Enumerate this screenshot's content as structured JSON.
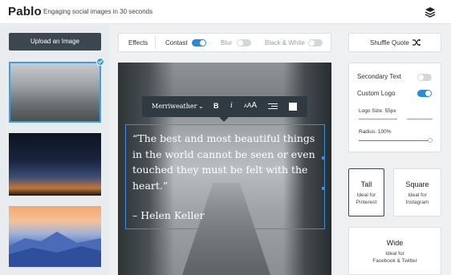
{
  "app": {
    "name": "Pablo",
    "tagline": "Engaging social images in 30 seconds",
    "header_icon": "layers-icon"
  },
  "sidebar": {
    "upload_label": "Upload an Image",
    "thumbnails": [
      {
        "name": "foggy-canyon",
        "selected": true
      },
      {
        "name": "night-sky-sunset",
        "selected": false
      },
      {
        "name": "blue-mountains-sunset",
        "selected": false
      }
    ]
  },
  "effects": {
    "label": "Effects",
    "contrast": {
      "label": "Contast",
      "on": true
    },
    "blur": {
      "label": "Blur",
      "on": false
    },
    "bw": {
      "label": "Black & White",
      "on": false
    }
  },
  "format_bar": {
    "font": "Merriweather",
    "bold": "B",
    "italic": "i",
    "size_small": "A",
    "size_large": "A",
    "align_icon": "align-icon",
    "color": "#ffffff"
  },
  "quote": {
    "text": "“The best and most beautiful things in the world cannot be seen or even touched they must be felt with the heart.”",
    "author": "– Helen Keller"
  },
  "right_panel": {
    "shuffle_label": "Shuffle Quote",
    "secondary_text": {
      "label": "Secondary Text",
      "on": false
    },
    "custom_logo": {
      "label": "Custom Logo",
      "on": true
    },
    "logo_size_label": "Logo Size: 55px",
    "radius_label": "Radius: 100%",
    "radius_value": 1.0,
    "sizes": [
      {
        "title": "Tall",
        "sub": "Ideal for\nPinterest",
        "selected": true
      },
      {
        "title": "Square",
        "sub": "Ideal for\nInstagram",
        "selected": false
      },
      {
        "title": "Wide",
        "sub": "Ideal for\nFacebook & Twitter",
        "selected": false
      }
    ]
  },
  "colors": {
    "accent": "#2b8ad8",
    "dark": "#3b4650",
    "toolbar_dark": "#2f3a43"
  }
}
